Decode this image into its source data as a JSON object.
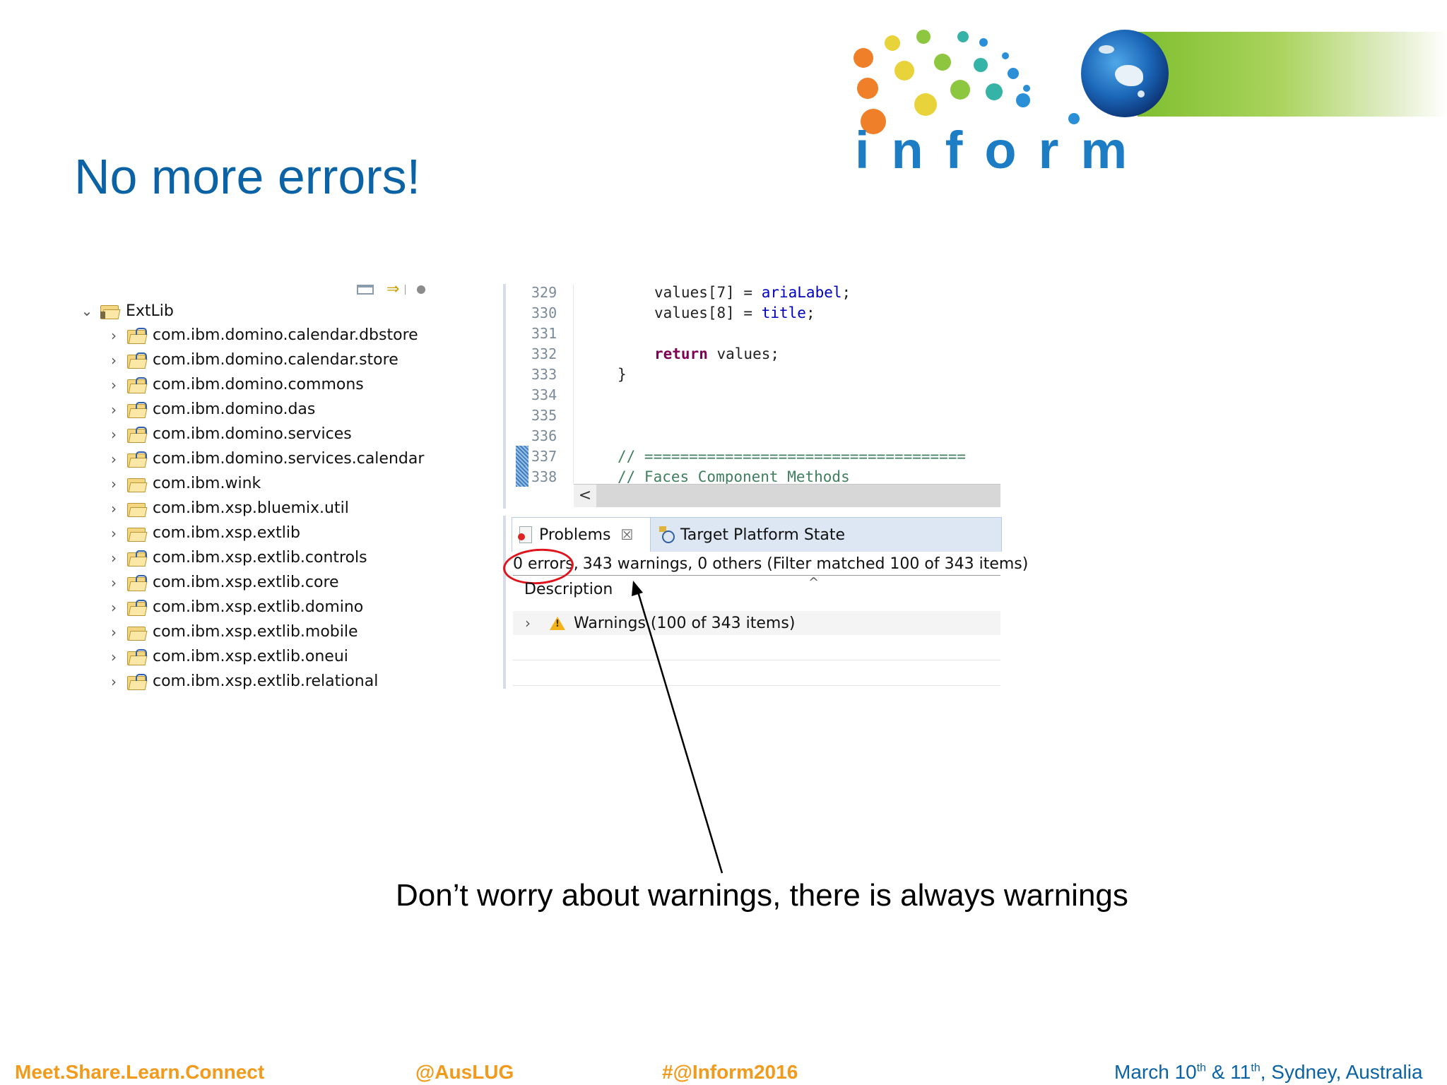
{
  "slide": {
    "title": "No more errors!",
    "caption": "Don’t worry about warnings, there is always warnings"
  },
  "logo": {
    "word": "inform",
    "colors": {
      "orange": "#f07f2a",
      "yellow": "#e9d33a",
      "green": "#8dc63f",
      "teal": "#35b3a7",
      "blue": "#2a8fd6"
    },
    "globe_icon": "globe-australia-icon"
  },
  "tree": {
    "root": "ExtLib",
    "items": [
      "com.ibm.domino.calendar.dbstore",
      "com.ibm.domino.calendar.store",
      "com.ibm.domino.commons",
      "com.ibm.domino.das",
      "com.ibm.domino.services",
      "com.ibm.domino.services.calendar",
      "com.ibm.wink",
      "com.ibm.xsp.bluemix.util",
      "com.ibm.xsp.extlib",
      "com.ibm.xsp.extlib.controls",
      "com.ibm.xsp.extlib.core",
      "com.ibm.xsp.extlib.domino",
      "com.ibm.xsp.extlib.mobile",
      "com.ibm.xsp.extlib.oneui",
      "com.ibm.xsp.extlib.relational"
    ]
  },
  "editor": {
    "line_numbers": [
      "329",
      "330",
      "331",
      "332",
      "333",
      "334",
      "335",
      "336",
      "337",
      "338"
    ],
    "lines": {
      "l329": {
        "lhs": "values[7] = ",
        "field": "ariaLabel",
        "end": ";"
      },
      "l330": {
        "lhs": "values[8] = ",
        "field": "title",
        "end": ";"
      },
      "l332": {
        "kw": "return",
        "rest": " values;"
      },
      "l333": "}",
      "l337": "// ====================================",
      "l338": "// Faces Component Methods"
    },
    "scroll_left": "<"
  },
  "problems": {
    "tab_problems": "Problems",
    "tab_close": "☒",
    "tab_target": "Target Platform State",
    "summary_errors": "0 errors,",
    "summary_rest": " 343 warnings, 0 others (Filter matched 100 of 343 items)",
    "column_description": "Description",
    "sort_indicator": "^",
    "warnings_row": "Warnings (100 of 343 items)"
  },
  "footer": {
    "tagline": "Meet.Share.Learn.Connect",
    "handle": "@AusLUG",
    "hashtag": "#@Inform2016",
    "date_pre": "March 10",
    "date_sup1": "th",
    "date_mid": " & 11",
    "date_sup2": "th",
    "date_post": ", Sydney, Australia"
  }
}
